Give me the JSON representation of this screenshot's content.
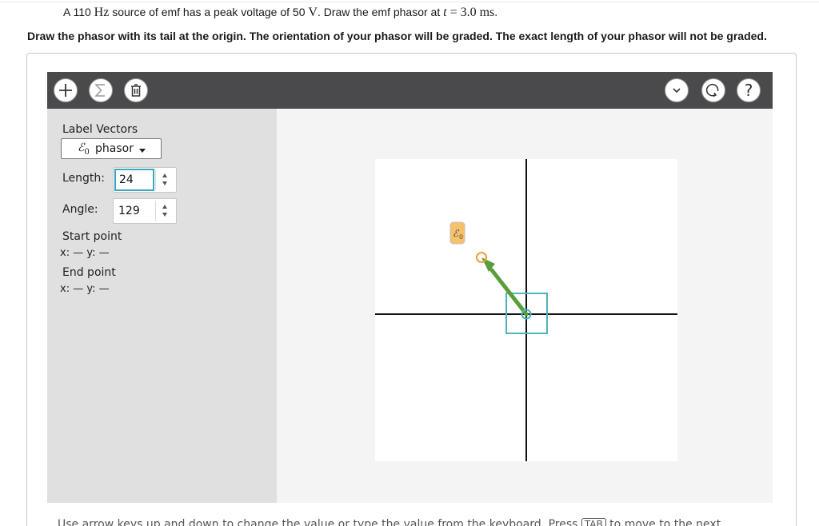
{
  "question": {
    "pre": "A 110 ",
    "freq_unit": "Hz",
    "mid": " source of emf has a peak voltage of 50 ",
    "volt_unit": "V",
    "post": ". Draw the emf phasor at ",
    "t_var": "t",
    "t_value": " = 3.0 ms",
    "end": "."
  },
  "instruction": "Draw the phasor with its tail at the origin. The orientation of your phasor will be graded. The exact length of your phasor will not be graded.",
  "toolbar": {
    "left_icons": [
      "plus-icon",
      "sigma-icon",
      "trash-icon"
    ],
    "right_icons": [
      "chevron-down-icon",
      "reset-icon",
      "help-icon"
    ],
    "help_label": "?"
  },
  "sidebar": {
    "label_vectors": "Label Vectors",
    "dropdown": {
      "symbol": "ℰ",
      "subscript": "0",
      "label": "phasor"
    },
    "length_label": "Length:",
    "length_value": "24",
    "angle_label": "Angle:",
    "angle_value": "129",
    "start_label": "Start point",
    "start_xy": "x: — y: —",
    "end_label": "End point",
    "end_xy": "x: — y: —"
  },
  "canvas": {
    "vector_label": "ℰ",
    "vector_label_sub": "0",
    "vector_angle_deg": 129,
    "colors": {
      "vector": "#5a9e3a",
      "selection": "#4fb5b8",
      "handle": "#e6a23c",
      "label_bg": "#f5c26b",
      "axes": "#111111"
    }
  },
  "footer": {
    "pre": "Use arrow keys up and down to change the value or type the value from the keyboard. Press ",
    "key": "TAB",
    "post": " to move to the next"
  },
  "colors": {
    "toolbar_bg": "#4a4a4d",
    "sidebar_bg": "#e0e0e0",
    "focus": "#3aa6c4"
  }
}
